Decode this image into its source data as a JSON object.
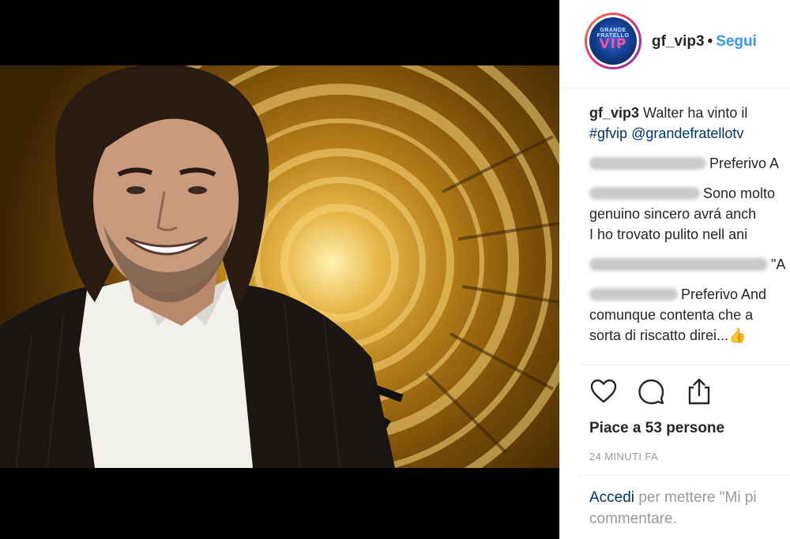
{
  "post": {
    "username": "gf_vip3",
    "separator": "•",
    "follow_label": "Segui",
    "avatar_logo_text": "VIP",
    "avatar_logo_sub": "GRANDE FRATELLO"
  },
  "caption": {
    "username": "gf_vip3",
    "text": "Walter ha vinto il",
    "hashtag": "#gfvip",
    "mention": "@grandefratellotv"
  },
  "comments": [
    {
      "text": "Preferivo A"
    },
    {
      "line1": "Sono molto",
      "line2": "genuino sincero avrá anch",
      "line3": "I ho trovato pulito nell ani"
    },
    {
      "text": "\"A"
    },
    {
      "line1": "Preferivo And",
      "line2": "comunque contenta che a",
      "line3": "sorta di riscatto direi...",
      "emoji": "👍"
    }
  ],
  "actions": {
    "like_icon": "heart-icon",
    "comment_icon": "comment-icon",
    "share_icon": "share-icon"
  },
  "likes_text": "Piace a 53 persone",
  "timestamp": "24 MINUTI FA",
  "login_prompt": {
    "link": "Accedi",
    "rest_line1": "per mettere \"Mi pi",
    "line2": "commentare."
  },
  "colors": {
    "link_blue": "#3897f0",
    "tag_blue": "#003569",
    "muted": "#999999",
    "text": "#262626"
  }
}
